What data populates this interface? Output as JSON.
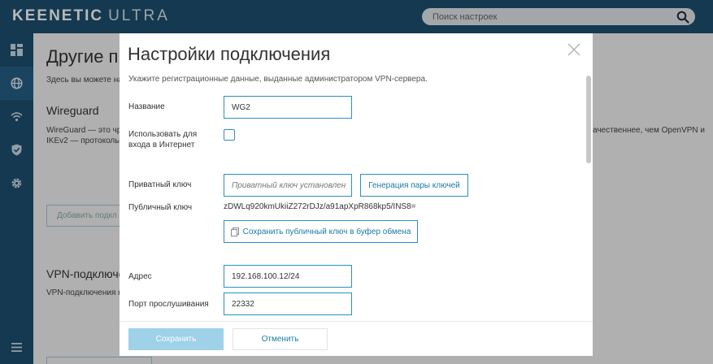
{
  "app": {
    "brand": "KEENETIC",
    "product": "ULTRA"
  },
  "search": {
    "placeholder": "Поиск настроек"
  },
  "sidebar": {
    "items": [
      {
        "icon": "dashboard-icon"
      },
      {
        "icon": "globe-icon"
      },
      {
        "icon": "wifi-icon"
      },
      {
        "icon": "shield-icon"
      },
      {
        "icon": "gear-icon"
      },
      {
        "icon": "menu-icon"
      }
    ]
  },
  "background": {
    "title": "Другие п",
    "intro": "Здесь вы можете на",
    "wireguard_heading": "Wireguard",
    "wireguard_text_1": "WireGuard — это чре",
    "wireguard_text_2": "IKEv2 — протоколы,",
    "wireguard_text_right": "ачественнее, чем OpenVPN и",
    "add_button": "Добавить подкл",
    "vpn_heading": "VPN-подключен",
    "vpn_text": "VPN-подключения к"
  },
  "modal": {
    "title": "Настройки подключения",
    "subtitle": "Укажите регистрационные данные, выданные администратором VPN-сервера.",
    "name_label": "Название",
    "name_value": "WG2",
    "internet_label_1": "Использовать для",
    "internet_label_2": "входа в Интернет",
    "internet_checked": false,
    "private_key_label": "Приватный ключ",
    "private_key_placeholder": "Приватный ключ установлен",
    "generate_button": "Генерация пары ключей",
    "public_key_label": "Публичный ключ",
    "public_key_value": "zDWLq920kmUkiiZ272rDJz/a91apXpR868kp5/INS8=",
    "copy_button": "Сохранить публичный ключ в буфер обмена",
    "address_label": "Адрес",
    "address_value": "192.168.100.12/24",
    "port_label": "Порт прослушивания",
    "port_value": "22332",
    "save_button": "Сохранить",
    "cancel_button": "Отменить"
  },
  "colors": {
    "header": "#1c4f70",
    "accent": "#2c8fbf",
    "save_disabled": "#9fd1e8"
  }
}
